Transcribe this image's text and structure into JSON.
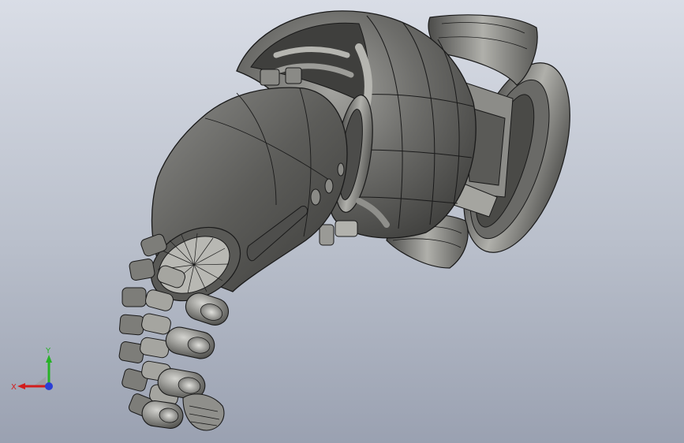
{
  "viewport": {
    "background_top": "#d9dde6",
    "background_bottom": "#9aa1b1"
  },
  "model": {
    "shading_color": "#6f6f6c",
    "edge_color": "#1a1a1a"
  },
  "triad": {
    "x_label": "X",
    "y_label": "Y",
    "x_color": "#d21d1d",
    "y_color": "#27b227",
    "z_color": "#2a3fd6"
  }
}
